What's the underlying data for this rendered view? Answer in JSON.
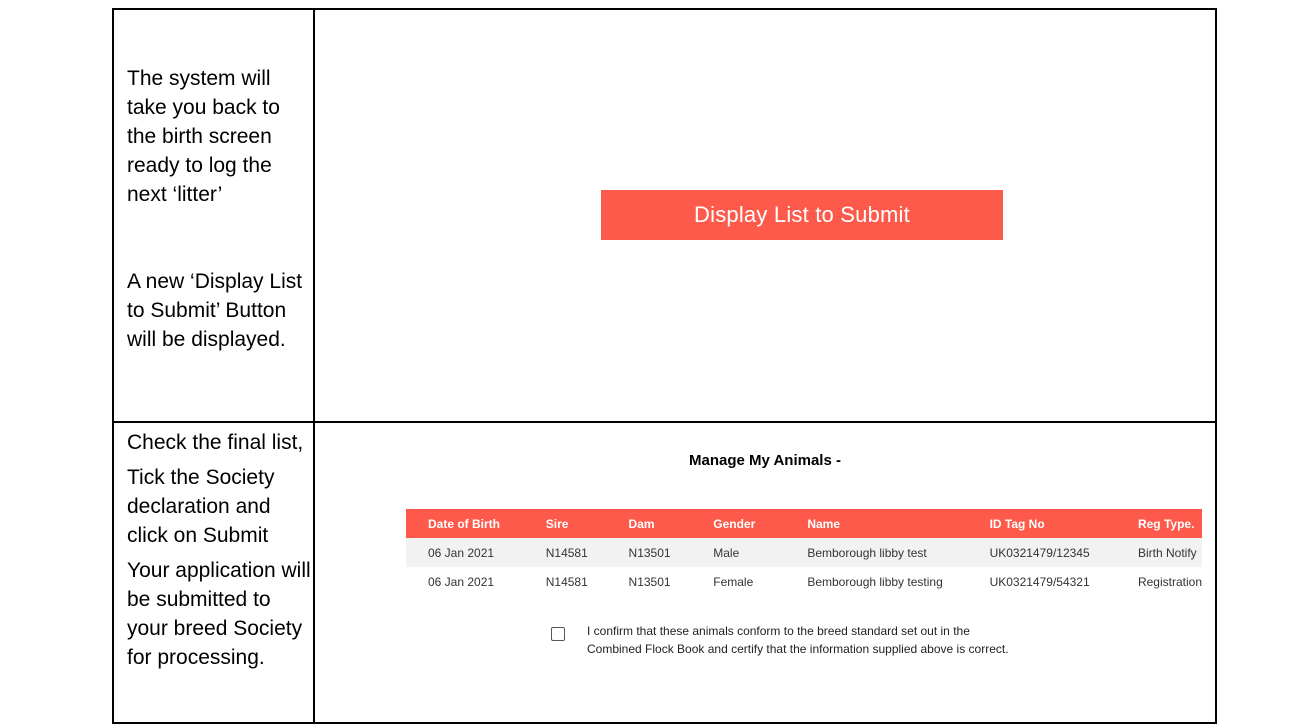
{
  "top_left": {
    "paragraph1": "The system will take you back to the birth screen ready to log the next ‘litter’",
    "paragraph2": "A new ‘Display List to Submit’ Button will be displayed."
  },
  "top_right": {
    "button_label": "Display List to Submit",
    "button_color": "#fd5a4c"
  },
  "bottom_left": {
    "line1": "Check the final list,",
    "line2": "Tick the Society declaration and click on Submit",
    "line3": "Your application will be submitted to your breed Society for processing."
  },
  "bottom_right": {
    "title": "Manage My Animals -",
    "table": {
      "headers": [
        "Date of Birth",
        "Sire",
        "Dam",
        "Gender",
        "Name",
        "ID Tag No",
        "Reg Type."
      ],
      "rows": [
        [
          "06 Jan 2021",
          "N14581",
          "N13501",
          "Male",
          "Bemborough libby test",
          "UK0321479/12345",
          "Birth Notify"
        ],
        [
          "06 Jan 2021",
          "N14581",
          "N13501",
          "Female",
          "Bemborough libby testing",
          "UK0321479/54321",
          "Registration"
        ]
      ]
    },
    "declaration": "I confirm that these animals conform to the breed standard set out in the Combined Flock Book and certify that the information supplied above is correct."
  }
}
